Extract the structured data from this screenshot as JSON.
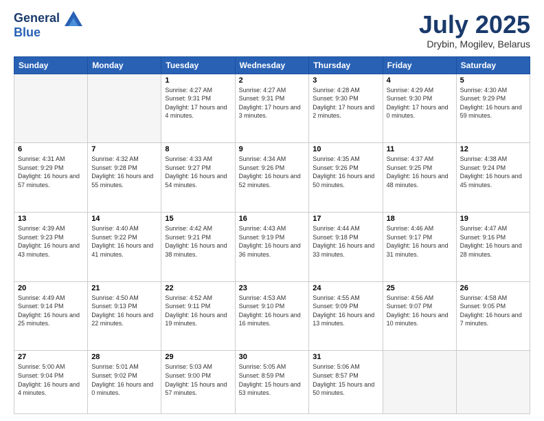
{
  "header": {
    "logo_line1": "General",
    "logo_line2": "Blue",
    "month_title": "July 2025",
    "location": "Drybin, Mogilev, Belarus"
  },
  "days_of_week": [
    "Sunday",
    "Monday",
    "Tuesday",
    "Wednesday",
    "Thursday",
    "Friday",
    "Saturday"
  ],
  "weeks": [
    [
      {
        "day": "",
        "empty": true
      },
      {
        "day": "",
        "empty": true
      },
      {
        "day": "1",
        "sunrise": "4:27 AM",
        "sunset": "9:31 PM",
        "daylight": "17 hours and 4 minutes."
      },
      {
        "day": "2",
        "sunrise": "4:27 AM",
        "sunset": "9:31 PM",
        "daylight": "17 hours and 3 minutes."
      },
      {
        "day": "3",
        "sunrise": "4:28 AM",
        "sunset": "9:30 PM",
        "daylight": "17 hours and 2 minutes."
      },
      {
        "day": "4",
        "sunrise": "4:29 AM",
        "sunset": "9:30 PM",
        "daylight": "17 hours and 0 minutes."
      },
      {
        "day": "5",
        "sunrise": "4:30 AM",
        "sunset": "9:29 PM",
        "daylight": "16 hours and 59 minutes."
      }
    ],
    [
      {
        "day": "6",
        "sunrise": "4:31 AM",
        "sunset": "9:29 PM",
        "daylight": "16 hours and 57 minutes."
      },
      {
        "day": "7",
        "sunrise": "4:32 AM",
        "sunset": "9:28 PM",
        "daylight": "16 hours and 55 minutes."
      },
      {
        "day": "8",
        "sunrise": "4:33 AM",
        "sunset": "9:27 PM",
        "daylight": "16 hours and 54 minutes."
      },
      {
        "day": "9",
        "sunrise": "4:34 AM",
        "sunset": "9:26 PM",
        "daylight": "16 hours and 52 minutes."
      },
      {
        "day": "10",
        "sunrise": "4:35 AM",
        "sunset": "9:26 PM",
        "daylight": "16 hours and 50 minutes."
      },
      {
        "day": "11",
        "sunrise": "4:37 AM",
        "sunset": "9:25 PM",
        "daylight": "16 hours and 48 minutes."
      },
      {
        "day": "12",
        "sunrise": "4:38 AM",
        "sunset": "9:24 PM",
        "daylight": "16 hours and 45 minutes."
      }
    ],
    [
      {
        "day": "13",
        "sunrise": "4:39 AM",
        "sunset": "9:23 PM",
        "daylight": "16 hours and 43 minutes."
      },
      {
        "day": "14",
        "sunrise": "4:40 AM",
        "sunset": "9:22 PM",
        "daylight": "16 hours and 41 minutes."
      },
      {
        "day": "15",
        "sunrise": "4:42 AM",
        "sunset": "9:21 PM",
        "daylight": "16 hours and 38 minutes."
      },
      {
        "day": "16",
        "sunrise": "4:43 AM",
        "sunset": "9:19 PM",
        "daylight": "16 hours and 36 minutes."
      },
      {
        "day": "17",
        "sunrise": "4:44 AM",
        "sunset": "9:18 PM",
        "daylight": "16 hours and 33 minutes."
      },
      {
        "day": "18",
        "sunrise": "4:46 AM",
        "sunset": "9:17 PM",
        "daylight": "16 hours and 31 minutes."
      },
      {
        "day": "19",
        "sunrise": "4:47 AM",
        "sunset": "9:16 PM",
        "daylight": "16 hours and 28 minutes."
      }
    ],
    [
      {
        "day": "20",
        "sunrise": "4:49 AM",
        "sunset": "9:14 PM",
        "daylight": "16 hours and 25 minutes."
      },
      {
        "day": "21",
        "sunrise": "4:50 AM",
        "sunset": "9:13 PM",
        "daylight": "16 hours and 22 minutes."
      },
      {
        "day": "22",
        "sunrise": "4:52 AM",
        "sunset": "9:11 PM",
        "daylight": "16 hours and 19 minutes."
      },
      {
        "day": "23",
        "sunrise": "4:53 AM",
        "sunset": "9:10 PM",
        "daylight": "16 hours and 16 minutes."
      },
      {
        "day": "24",
        "sunrise": "4:55 AM",
        "sunset": "9:09 PM",
        "daylight": "16 hours and 13 minutes."
      },
      {
        "day": "25",
        "sunrise": "4:56 AM",
        "sunset": "9:07 PM",
        "daylight": "16 hours and 10 minutes."
      },
      {
        "day": "26",
        "sunrise": "4:58 AM",
        "sunset": "9:05 PM",
        "daylight": "16 hours and 7 minutes."
      }
    ],
    [
      {
        "day": "27",
        "sunrise": "5:00 AM",
        "sunset": "9:04 PM",
        "daylight": "16 hours and 4 minutes."
      },
      {
        "day": "28",
        "sunrise": "5:01 AM",
        "sunset": "9:02 PM",
        "daylight": "16 hours and 0 minutes."
      },
      {
        "day": "29",
        "sunrise": "5:03 AM",
        "sunset": "9:00 PM",
        "daylight": "15 hours and 57 minutes."
      },
      {
        "day": "30",
        "sunrise": "5:05 AM",
        "sunset": "8:59 PM",
        "daylight": "15 hours and 53 minutes."
      },
      {
        "day": "31",
        "sunrise": "5:06 AM",
        "sunset": "8:57 PM",
        "daylight": "15 hours and 50 minutes."
      },
      {
        "day": "",
        "empty": true
      },
      {
        "day": "",
        "empty": true
      }
    ]
  ],
  "labels": {
    "sunrise": "Sunrise:",
    "sunset": "Sunset:",
    "daylight": "Daylight:"
  }
}
